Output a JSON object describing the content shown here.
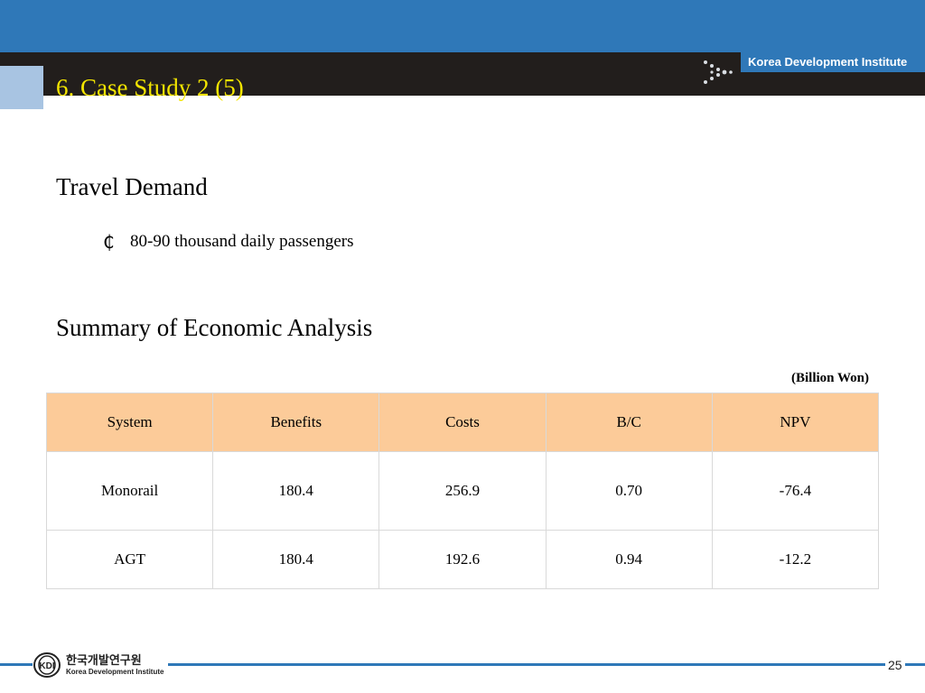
{
  "header": {
    "title": "6. Case Study 2 (5)",
    "institute": "Korea Development Institute"
  },
  "sections": [
    {
      "heading": "Travel Demand",
      "bullets": [
        {
          "icon": "cent-icon",
          "text": "80-90 thousand daily passengers"
        }
      ]
    },
    {
      "heading": "Summary of Economic Analysis"
    }
  ],
  "table": {
    "unit_note": "(Billion Won)",
    "columns": [
      "System",
      "Benefits",
      "Costs",
      "B/C",
      "NPV"
    ],
    "rows": [
      [
        "Monorail",
        "180.4",
        "256.9",
        "0.70",
        "-76.4"
      ],
      [
        "AGT",
        "180.4",
        "192.6",
        "0.94",
        "-12.2"
      ]
    ],
    "header_color": "#fccb99"
  },
  "footer": {
    "logo_korean": "한국개발연구원",
    "logo_english": "Korea Development Institute",
    "page_number": "25"
  },
  "colors": {
    "brand_blue": "#2f78b8",
    "header_dark": "#221e1c",
    "title_yellow": "#f2e400",
    "accent_light_blue": "#a8c4e2"
  }
}
